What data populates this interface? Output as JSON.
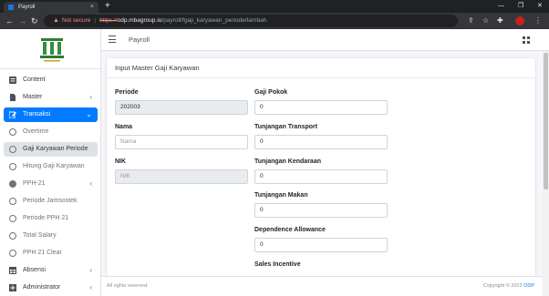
{
  "browser": {
    "tab_title": "Payroll",
    "tab_close": "×",
    "new_tab": "+",
    "minimize": "—",
    "maximize": "❐",
    "close": "✕",
    "not_secure": "Not secure",
    "url_scheme": "https://",
    "url_host": "odp.mbagroup.io",
    "url_path": "/payroll/fgaji_karyawan_periode/tambah"
  },
  "topnav": {
    "title": "Payroll"
  },
  "sidebar": {
    "items": [
      {
        "label": "Content",
        "icon": "content-icon"
      },
      {
        "label": "Master",
        "icon": "file-icon"
      },
      {
        "label": "Transaksi",
        "icon": "edit-icon"
      },
      {
        "label": "Overtime"
      },
      {
        "label": "Gaji Karyawan Periode"
      },
      {
        "label": "Hitung Gaji Karyawan"
      },
      {
        "label": "PPH-21"
      },
      {
        "label": "Periode Jamsostek"
      },
      {
        "label": "Periode PPH 21"
      },
      {
        "label": "Total Salary"
      },
      {
        "label": "PPH 21 Clear"
      },
      {
        "label": "Absensi",
        "icon": "table-icon"
      },
      {
        "label": "Administrator",
        "icon": "plus-square-icon"
      }
    ]
  },
  "form": {
    "title": "Input Master Gaji Karyawan",
    "periode_label": "Periode",
    "periode_value": "202003",
    "nama_label": "Nama",
    "nama_placeholder": "Nama",
    "nik_label": "NIK",
    "nik_placeholder": "NIK",
    "gaji_pokok_label": "Gaji Pokok",
    "gaji_pokok_value": "0",
    "transport_label": "Tunjangan Transport",
    "transport_value": "0",
    "kendaraan_label": "Tunjangan Kendaraan",
    "kendaraan_value": "0",
    "makan_label": "Tunjangan Makan",
    "makan_value": "0",
    "dependence_label": "Dependence Allowance",
    "dependence_value": "0",
    "sales_label": "Sales Incentive"
  },
  "footer": {
    "left": "All rights reserved.",
    "right_prefix": "Copyright © 2022 ",
    "right_link": "ODP"
  },
  "colors": {
    "primary": "#007bff",
    "chrome_dark": "#202124",
    "chrome_mid": "#35363a"
  }
}
